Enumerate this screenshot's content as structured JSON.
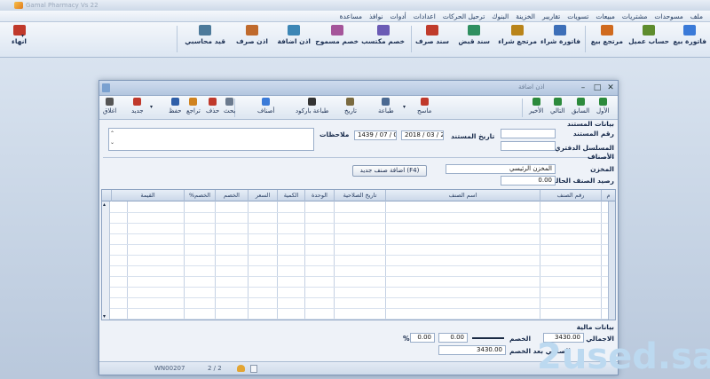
{
  "app": {
    "title": "Gamal Pharmacy Vs 22",
    "menubar": [
      "ملف",
      "مسوحدات",
      "مشتريات",
      "مبيعات",
      "تسويات",
      "تقاريبر",
      "الخزينة",
      "البنوك",
      "ترحيل الحركات",
      "اعدادات",
      "أدوات",
      "نوافذ",
      "مساعدة"
    ],
    "ribbon": [
      {
        "label": "فاتورة بيع",
        "icon": "invoice-sale-icon",
        "color": "#3a7ad8"
      },
      {
        "label": "حساب عميل",
        "icon": "customer-account-icon",
        "color": "#5e8c2d"
      },
      {
        "label": "مرتجع بيع",
        "icon": "sale-return-icon",
        "color": "#d06a1e"
      },
      {
        "label": "فاتورة شراء",
        "icon": "invoice-purchase-icon",
        "color": "#3d6fb8"
      },
      {
        "label": "مرتجع شراء",
        "icon": "purchase-return-icon",
        "color": "#b9841a"
      },
      {
        "label": "سند قبض",
        "icon": "receipt-voucher-icon",
        "color": "#2f8f60"
      },
      {
        "label": "سند صرف",
        "icon": "payment-voucher-icon",
        "color": "#c03b2b"
      },
      {
        "label": "خصم مكتسب",
        "icon": "earned-discount-icon",
        "color": "#6b5bb5"
      },
      {
        "label": "خصم مسموح",
        "icon": "allowed-discount-icon",
        "color": "#a5559a"
      },
      {
        "label": "اذن اضافة",
        "icon": "add-permit-icon",
        "color": "#3c86b5"
      },
      {
        "label": "اذن صرف",
        "icon": "issue-permit-icon",
        "color": "#c06a2c"
      },
      {
        "label": "قيد محاسبي",
        "icon": "journal-entry-icon",
        "color": "#4d7a9a"
      },
      {
        "label": "انهاء",
        "icon": "exit-icon",
        "color": "#c0392b"
      }
    ]
  },
  "window": {
    "title": "اذن اضافة",
    "toolbar": [
      {
        "label": "الأول",
        "icon": "first-icon",
        "color": "#2c8a3c"
      },
      {
        "label": "السابق",
        "icon": "previous-icon",
        "color": "#2c8a3c"
      },
      {
        "label": "التالي",
        "icon": "next-icon",
        "color": "#2c8a3c"
      },
      {
        "label": "الأخير",
        "icon": "last-icon",
        "color": "#2c8a3c"
      },
      {
        "label": "ماسح",
        "icon": "scanner-icon",
        "color": "#c0392b"
      },
      {
        "label": "طباعة",
        "icon": "print-icon",
        "color": "#4c6a92"
      },
      {
        "label": "تاريخ",
        "icon": "history-icon",
        "color": "#7a6a40"
      },
      {
        "label": "طباعة باركود",
        "icon": "barcode-icon",
        "color": "#333333"
      },
      {
        "label": "أصناف",
        "icon": "items-icon",
        "color": "#3a7ad8"
      },
      {
        "label": "بحث",
        "icon": "search-icon",
        "color": "#6b7a8e"
      },
      {
        "label": "حذف",
        "icon": "delete-icon",
        "color": "#c0392b"
      },
      {
        "label": "تراجع",
        "icon": "undo-icon",
        "color": "#d0821e"
      },
      {
        "label": "حفظ",
        "icon": "save-icon",
        "color": "#2f5fa8"
      },
      {
        "label": "جديد",
        "icon": "new-icon",
        "color": "#c0392b"
      },
      {
        "label": "اغلاق",
        "icon": "close-icon",
        "color": "#555555"
      }
    ],
    "header": {
      "section_label": "بيانات المستند",
      "doc_number_label": "رقم المستند",
      "doc_number_value": "",
      "manual_serial_label": "المسلسل الدفتري",
      "manual_serial_value": "",
      "doc_date_label": "تاريخ المستند",
      "doc_date_gregorian": "2018 / 03 / 24",
      "doc_date_hijri": "1439 / 07 / 08",
      "notes_label": "ملاحظات",
      "notes_value": "",
      "items_section_label": "الأصناف",
      "warehouse_label": "المخزن",
      "warehouse_value": "المخزن الرئيسي",
      "current_balance_label": "رصيد الصنف الحالي",
      "current_balance_value": "0.00",
      "add_item_button": "اضافة صنف جديد (F4)"
    },
    "grid": {
      "columns": [
        "م",
        "رقم الصنف",
        "اسم الصنف",
        "تاريخ الصلاحية",
        "الوحدة",
        "الكمية",
        "السعر",
        "الخصم",
        "الخصم%",
        "القيمة"
      ],
      "rows": 11
    },
    "footer": {
      "section_label": "بيانات مالية",
      "total_label": "الاجمالي",
      "total_value": "3430.00",
      "discount_label": "الخصم",
      "discount_value": "0.00",
      "discount_pct_value": "0.00",
      "pct_sign": "%",
      "net_label": "الصافي بعد الخصم",
      "net_value": "3430.00"
    },
    "status": {
      "user": "WN00207",
      "pager": "2 / 2"
    }
  },
  "watermark": "2used.sa"
}
